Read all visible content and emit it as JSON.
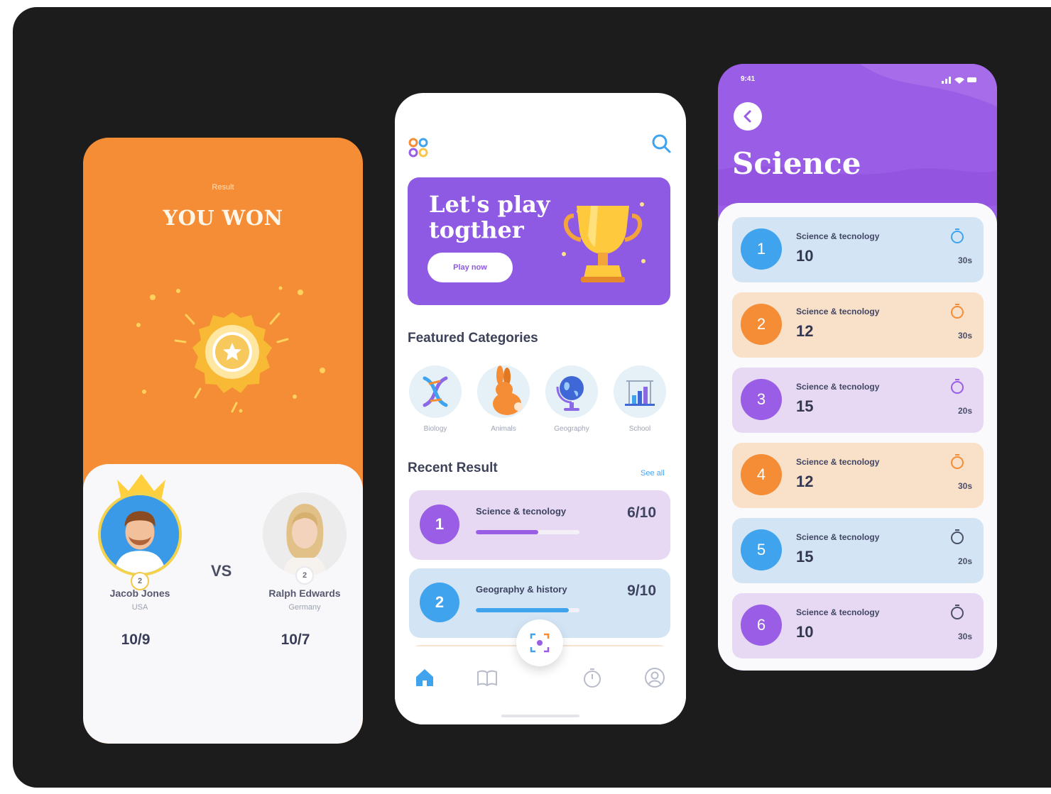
{
  "colors": {
    "orange": "#f48d35",
    "purple": "#9a5de5",
    "blue": "#3fa3ee",
    "bg_dark": "#1c1c1d"
  },
  "result_screen": {
    "label": "Result",
    "headline": "YOU WON",
    "vs": "VS",
    "player1": {
      "name": "Jacob Jones",
      "country": "USA",
      "score": "10/9",
      "rank": "2"
    },
    "player2": {
      "name": "Ralph Edwards",
      "country": "Germany",
      "score": "10/7",
      "rank": "2"
    }
  },
  "home_screen": {
    "banner": {
      "title": "Let's play togther",
      "button": "Play now"
    },
    "featured_title": "Featured Categories",
    "categories": [
      {
        "label": "Biology",
        "icon": "dna-icon"
      },
      {
        "label": "Animals",
        "icon": "rabbit-icon"
      },
      {
        "label": "Geography",
        "icon": "globe-icon"
      },
      {
        "label": "School",
        "icon": "school-icon"
      }
    ],
    "recent_title": "Recent Result",
    "see_all": "See all",
    "recent": [
      {
        "num": "1",
        "title": "Science & tecnology",
        "score": "6/10",
        "progress": 0.6
      },
      {
        "num": "2",
        "title": "Geography & history",
        "score": "9/10",
        "progress": 0.9
      }
    ],
    "tabs": [
      "home-icon",
      "book-icon",
      "timer-icon",
      "profile-icon"
    ]
  },
  "science_screen": {
    "status_time": "9:41",
    "title": "Science",
    "items": [
      {
        "num": "1",
        "subtitle": "Science & tecnology",
        "value": "10",
        "time": "30s",
        "theme": "blue"
      },
      {
        "num": "2",
        "subtitle": "Science & tecnology",
        "value": "12",
        "time": "30s",
        "theme": "orange"
      },
      {
        "num": "3",
        "subtitle": "Science & tecnology",
        "value": "15",
        "time": "20s",
        "theme": "purple"
      },
      {
        "num": "4",
        "subtitle": "Science & tecnology",
        "value": "12",
        "time": "30s",
        "theme": "orange"
      },
      {
        "num": "5",
        "subtitle": "Science & tecnology",
        "value": "15",
        "time": "20s",
        "theme": "blue"
      },
      {
        "num": "6",
        "subtitle": "Science & tecnology",
        "value": "10",
        "time": "30s",
        "theme": "purple"
      }
    ]
  }
}
